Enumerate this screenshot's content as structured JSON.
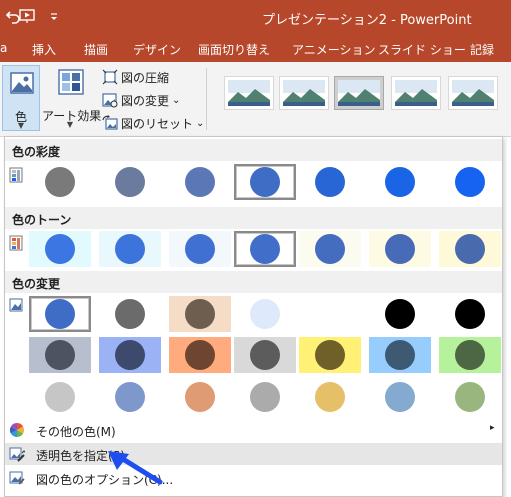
{
  "titlebar": {
    "doc_title": "プレゼンテーション2  -  PowerPoint"
  },
  "menubar": {
    "items": [
      "挿入",
      "描画",
      "デザイン",
      "画面切り替え",
      "アニメーション",
      "スライド ショー",
      "記録"
    ]
  },
  "ribbon": {
    "color_button": {
      "label": "色",
      "icon": "picture-color-icon"
    },
    "artistic_effects": {
      "label": "アート効果",
      "icon": "artistic-effects-icon"
    },
    "commands": [
      {
        "label": "図の圧縮",
        "icon": "compress-pictures-icon"
      },
      {
        "label": "図の変更",
        "icon": "change-picture-icon",
        "has_dropdown": true,
        "chevron": "⌄"
      },
      {
        "label": "図のリセット",
        "icon": "reset-picture-icon",
        "has_dropdown": true,
        "chevron": "⌄"
      }
    ],
    "style_gallery": {
      "item_count": 5,
      "selected_index": 2
    }
  },
  "dropdown": {
    "saturation": {
      "title": "色の彩度",
      "selected_index": 3,
      "swatches": [
        {
          "circle": "#7a7a7a",
          "bg": "#ffffff"
        },
        {
          "circle": "#6b7b9e",
          "bg": "#ffffff"
        },
        {
          "circle": "#5b77b5",
          "bg": "#ffffff"
        },
        {
          "circle": "#3f6cc4",
          "bg": "#ffffff"
        },
        {
          "circle": "#2866d6",
          "bg": "#ffffff"
        },
        {
          "circle": "#1a64e6",
          "bg": "#ffffff"
        },
        {
          "circle": "#1563f0",
          "bg": "#ffffff"
        }
      ]
    },
    "tone": {
      "title": "色のトーン",
      "selected_index": 3,
      "swatches": [
        {
          "circle": "#3c76e2",
          "bg": "#e0fafd"
        },
        {
          "circle": "#3d74db",
          "bg": "#e9f8fc"
        },
        {
          "circle": "#3f70d2",
          "bg": "#f2f8fb"
        },
        {
          "circle": "#416ec8",
          "bg": "#ffffff"
        },
        {
          "circle": "#446cbf",
          "bg": "#fbfbf0"
        },
        {
          "circle": "#476bb6",
          "bg": "#fdfbe3"
        },
        {
          "circle": "#4a6aae",
          "bg": "#fef9d9"
        }
      ]
    },
    "recolor": {
      "title": "色の変更",
      "selected_index": 0,
      "rows": [
        [
          {
            "circle": "#3f6cc4",
            "bg": "#ffffff"
          },
          {
            "circle": "#6b6b6b",
            "bg": "#ffffff"
          },
          {
            "circle": "#6e5e50",
            "bg": "#f4dcc7"
          },
          {
            "circle": "#deeafc",
            "bg": "#ffffff"
          },
          {
            "circle": "#ffffff",
            "bg": "#ffffff"
          },
          {
            "circle": "#000000",
            "bg": "#ffffff"
          },
          {
            "circle": "#000000",
            "bg": "#ffffff"
          }
        ],
        [
          {
            "circle": "#4d5361",
            "bg": "#b7bfcf"
          },
          {
            "circle": "#3d4a6e",
            "bg": "#9bb3f5"
          },
          {
            "circle": "#6e4530",
            "bg": "#ffab7d"
          },
          {
            "circle": "#5c5c5c",
            "bg": "#d9d9d9"
          },
          {
            "circle": "#6e6028",
            "bg": "#fff176"
          },
          {
            "circle": "#3e5a73",
            "bg": "#96cdfd"
          },
          {
            "circle": "#4d6643",
            "bg": "#b6f29b"
          }
        ],
        [
          {
            "circle": "#c6c6c6",
            "bg": "#ffffff"
          },
          {
            "circle": "#7f98cc",
            "bg": "#ffffff"
          },
          {
            "circle": "#de9b74",
            "bg": "#ffffff"
          },
          {
            "circle": "#ababab",
            "bg": "#ffffff"
          },
          {
            "circle": "#e6c068",
            "bg": "#ffffff"
          },
          {
            "circle": "#84aad0",
            "bg": "#ffffff"
          },
          {
            "circle": "#98b67e",
            "bg": "#ffffff"
          }
        ]
      ]
    },
    "menu": [
      {
        "label": "その他の色(M)",
        "icon": "color-wheel-icon",
        "submenu": true,
        "arrow": "▸"
      },
      {
        "label": "透明色を指定(S)",
        "icon": "set-transparent-icon",
        "highlighted": true
      },
      {
        "label": "図の色のオプション(C)...",
        "icon": "picture-color-options-icon"
      }
    ]
  },
  "annotation": {
    "color": "#1f4ef0"
  }
}
